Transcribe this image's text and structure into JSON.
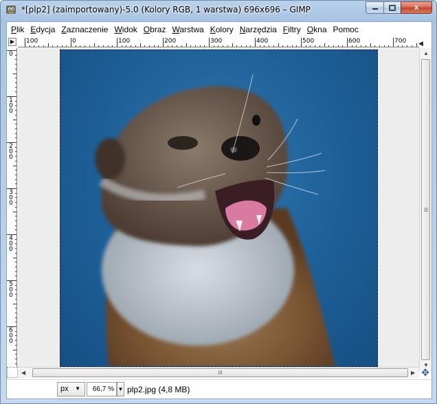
{
  "window": {
    "title": "*[plp2] (zaimportowany)-5.0 (Kolory RGB, 1 warstwa) 696x696 – GIMP",
    "app_icon": "gimp-icon",
    "controls": {
      "minimize_icon": "minimize-icon",
      "maximize_icon": "maximize-icon",
      "close_label": "x"
    }
  },
  "menubar": {
    "items": [
      "Plik",
      "Edycja",
      "Zaznaczenie",
      "Widok",
      "Obraz",
      "Warstwa",
      "Kolory",
      "Narzędzia",
      "Filtry",
      "Okna",
      "Pomoc"
    ]
  },
  "rulers": {
    "horizontal_labels": [
      "100",
      "0",
      "100",
      "200",
      "300",
      "400",
      "500",
      "600",
      "700"
    ],
    "vertical_labels": [
      "0",
      "100",
      "200",
      "300",
      "400",
      "500",
      "600"
    ]
  },
  "canvas": {
    "image_name": "otter-photo",
    "background_color": "#ededed",
    "image_bg_color": "#1e5f98"
  },
  "scrollbars": {
    "thumb_grip": "III"
  },
  "statusbar": {
    "unit": "px",
    "zoom": "66,7 %",
    "file_info": "plp2.jpg (4,8 MB)"
  }
}
